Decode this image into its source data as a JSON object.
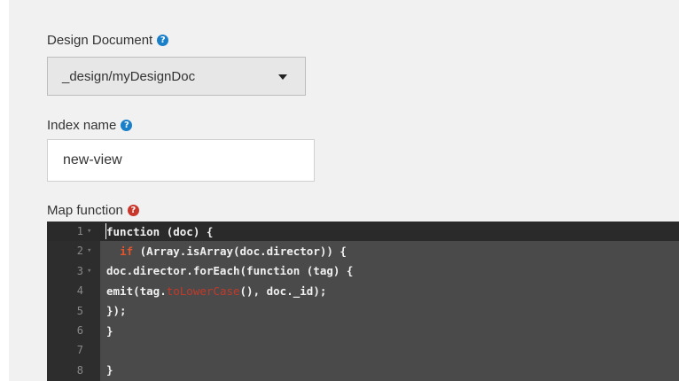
{
  "design_document": {
    "label": "Design Document",
    "help_icon": "question-circle-icon",
    "selected": "_design/myDesignDoc"
  },
  "index_name": {
    "label": "Index name",
    "help_icon": "question-circle-icon",
    "value": "new-view"
  },
  "map_function": {
    "label": "Map function",
    "help_icon": "question-circle-icon",
    "lines": [
      {
        "num": "1",
        "pre": "function (doc) {",
        "hl": "",
        "post": ""
      },
      {
        "num": "2",
        "pre": "  ",
        "hl": "if",
        "post": " (Array.isArray(doc.director)) {"
      },
      {
        "num": "3",
        "pre": "doc.director.forEach(function (tag) {",
        "hl": "",
        "post": ""
      },
      {
        "num": "4",
        "pre": "emit(tag.",
        "hl": "toLowerCase",
        "post": "(), doc._id);"
      },
      {
        "num": "5",
        "pre": "});",
        "hl": "",
        "post": ""
      },
      {
        "num": "6",
        "pre": "}",
        "hl": "",
        "post": ""
      },
      {
        "num": "7",
        "pre": "",
        "hl": "",
        "post": ""
      },
      {
        "num": "8",
        "pre": "}",
        "hl": "",
        "post": ""
      }
    ]
  },
  "colors": {
    "help_blue": "#1a7fc9",
    "help_red": "#c9372c",
    "editor_bg": "#4a4a4a",
    "keyword": "#e0552d"
  }
}
